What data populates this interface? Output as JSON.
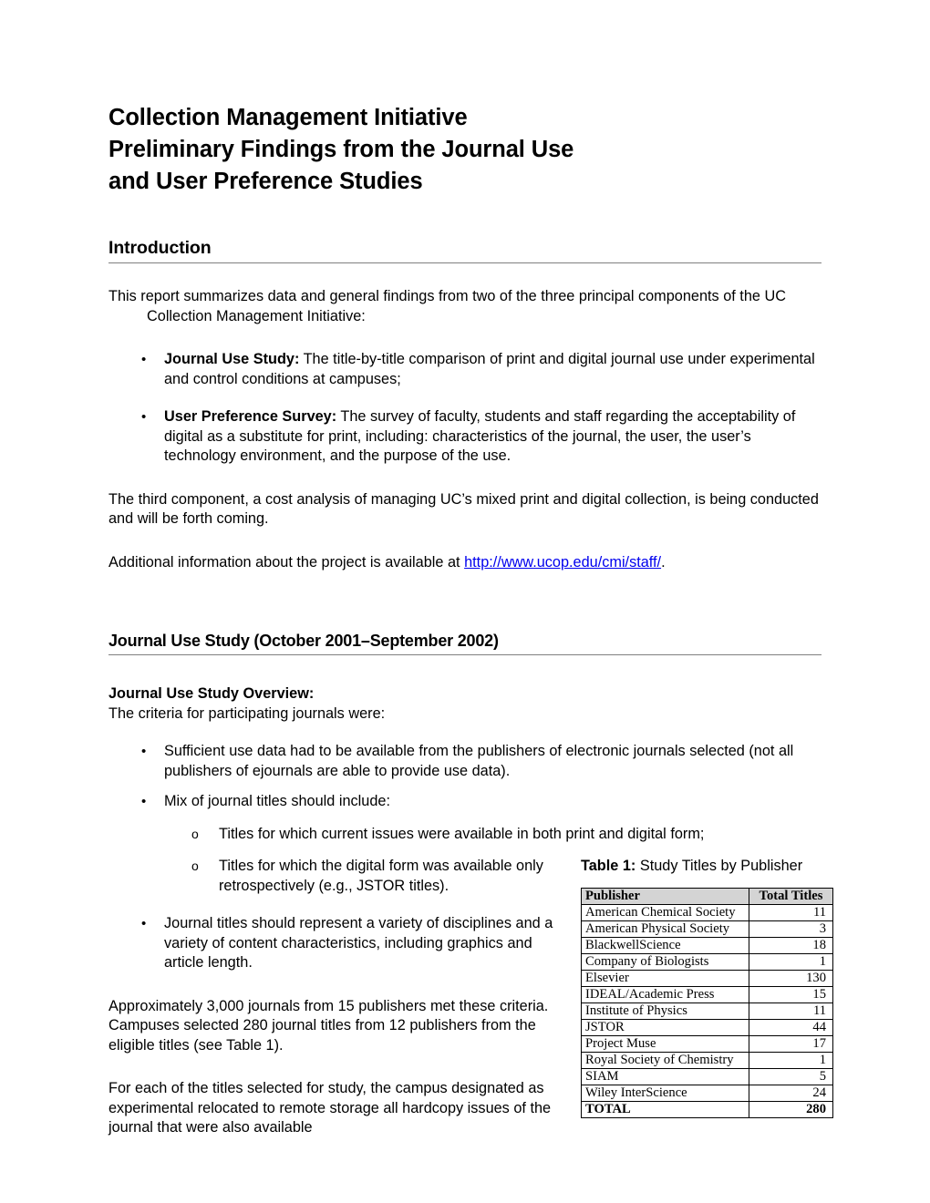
{
  "document": {
    "title_lines": [
      "Collection Management Initiative",
      "Preliminary Findings from the Journal Use",
      "and User Preference Studies"
    ]
  },
  "introduction": {
    "heading": "Introduction",
    "intro_paragraph": "This report summarizes data and general findings from two of the three principal components of the UC Collection Management Initiative:",
    "bullets": [
      {
        "marker": "•",
        "lead": "Journal Use Study:",
        "text": " The title-by-title comparison of print and digital journal use under experimental and control conditions at campuses;"
      },
      {
        "marker": "•",
        "lead": "User Preference Survey:",
        "text": " The survey of faculty, students and staff regarding the acceptability of digital as a substitute for print, including: characteristics of the journal, the user, the user’s technology environment, and the purpose of the use."
      }
    ],
    "third_component_paragraph": "The third component, a cost analysis of managing UC’s mixed print and digital collection, is being conducted and will be forth coming.",
    "additional_info_prefix": "Additional information about the project is available at ",
    "additional_info_link": "http://www.ucop.edu/cmi/staff/",
    "additional_info_suffix": "."
  },
  "journal_use_study": {
    "heading": "Journal Use Study (October 2001–September 2002)",
    "overview_label": "Journal Use Study Overview:",
    "overview_text": "The criteria for participating journals were:",
    "criteria_bullets": [
      {
        "marker": "•",
        "text": "Sufficient use data had to be available from the publishers of electronic journals selected (not all publishers of ejournals are able to provide use data)."
      },
      {
        "marker": "•",
        "text": "Mix of journal titles should include:"
      }
    ],
    "sub_bullets": [
      {
        "marker": "o",
        "text": "Titles for which current issues were available in both print and digital form;"
      },
      {
        "marker": "o",
        "text": "Titles for which the digital form was available only retrospectively (e.g., JSTOR titles)."
      }
    ],
    "variety_bullet": {
      "marker": "•",
      "text": "Journal titles should represent a variety of disciplines and a variety of content characteristics, including graphics and article length."
    },
    "paragraph_approx": "Approximately 3,000 journals from 15 publishers met these criteria.  Campuses selected 280 journal titles from 12 publishers from the eligible titles (see Table 1).",
    "paragraph_each_title": "For each of the titles selected for study, the campus designated as experimental relocated to remote storage all hardcopy issues of the journal that were also available"
  },
  "table1": {
    "caption_label": "Table 1:",
    "caption_text": " Study Titles by Publisher",
    "columns": [
      "Publisher",
      "Total Titles"
    ],
    "rows": [
      {
        "publisher": "American Chemical Society",
        "total": "11"
      },
      {
        "publisher": "American Physical Society",
        "total": "3"
      },
      {
        "publisher": "BlackwellScience",
        "total": "18"
      },
      {
        "publisher": "Company of Biologists",
        "total": "1"
      },
      {
        "publisher": "Elsevier",
        "total": "130"
      },
      {
        "publisher": "IDEAL/Academic Press",
        "total": "15"
      },
      {
        "publisher": "Institute of Physics",
        "total": "11"
      },
      {
        "publisher": "JSTOR",
        "total": "44"
      },
      {
        "publisher": "Project Muse",
        "total": "17"
      },
      {
        "publisher": "Royal Society of Chemistry",
        "total": "1"
      },
      {
        "publisher": "SIAM",
        "total": "5"
      },
      {
        "publisher": "Wiley InterScience",
        "total": "24"
      }
    ],
    "total_row": {
      "publisher": "TOTAL",
      "total": "280"
    }
  },
  "colors": {
    "link": "#0000ee",
    "rule": "#808080",
    "table_header_bg": "#d4d4d4",
    "text": "#000000"
  }
}
